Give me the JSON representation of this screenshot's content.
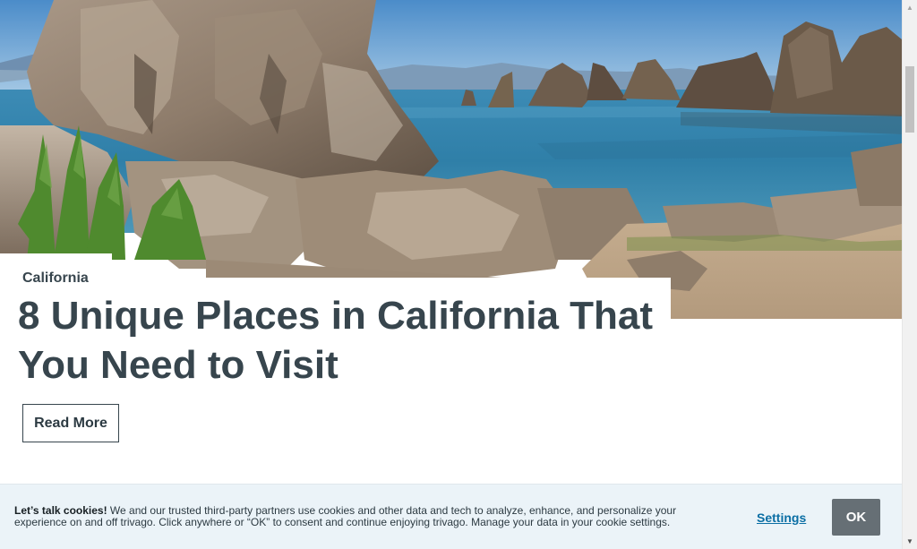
{
  "article": {
    "category": "California",
    "title": "8 Unique Places in California That You Need to Visit",
    "read_more_label": "Read More"
  },
  "hero_image": {
    "icon": "mono-lake-tufa-photo"
  },
  "cookie_banner": {
    "heading": "Let’s talk cookies!",
    "body": " We and our trusted third-party partners use cookies and other data and tech to analyze, enhance, and personalize your experience on and off trivago. Click anywhere or “OK” to consent and continue enjoying trivago. Manage your data in your cookie settings.",
    "settings_label": "Settings",
    "ok_label": "OK"
  },
  "scrollbar": {
    "up_icon": "▲",
    "down_icon": "▼"
  },
  "colors": {
    "text": "#37454d",
    "banner_bg": "#ebf3f8",
    "link": "#0a6ea4",
    "ok_button": "#666f75"
  }
}
